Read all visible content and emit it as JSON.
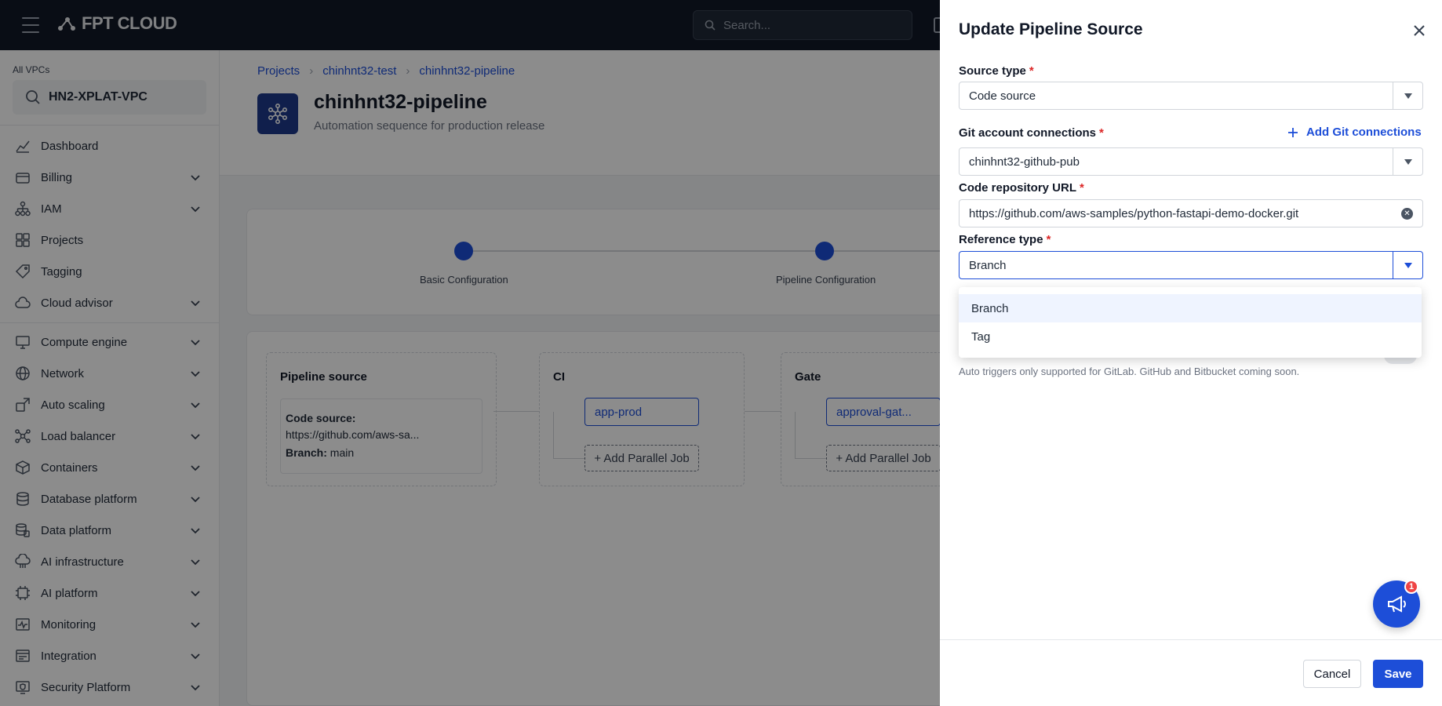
{
  "topbar": {
    "logo_text": "FPT CLOUD",
    "search_placeholder": "Search..."
  },
  "sidebar": {
    "vpc_label": "All VPCs",
    "vpc_value": "HN2-XPLAT-VPC",
    "items": [
      {
        "label": "Dashboard",
        "icon": "chart-icon"
      },
      {
        "label": "Billing",
        "icon": "wallet-icon"
      },
      {
        "label": "IAM",
        "icon": "org-icon"
      },
      {
        "label": "Projects",
        "icon": "grid-icon"
      },
      {
        "label": "Tagging",
        "icon": "tag-icon"
      },
      {
        "label": "Cloud advisor",
        "icon": "cloud-icon"
      },
      {
        "label": "Compute engine",
        "icon": "monitor-icon"
      },
      {
        "label": "Network",
        "icon": "globe-icon"
      },
      {
        "label": "Auto scaling",
        "icon": "scaling-icon"
      },
      {
        "label": "Load balancer",
        "icon": "balancer-icon"
      },
      {
        "label": "Containers",
        "icon": "cube-icon"
      },
      {
        "label": "Database platform",
        "icon": "database-icon"
      },
      {
        "label": "Data platform",
        "icon": "stack-icon"
      },
      {
        "label": "AI infrastructure",
        "icon": "cloud-chip-icon"
      },
      {
        "label": "AI platform",
        "icon": "ai-chip-icon"
      },
      {
        "label": "Monitoring",
        "icon": "pulse-icon"
      },
      {
        "label": "Integration",
        "icon": "api-icon"
      },
      {
        "label": "Security Platform",
        "icon": "shield-icon"
      }
    ]
  },
  "main": {
    "breadcrumb": [
      "Projects",
      "chinhnt32-test",
      "chinhnt32-pipeline"
    ],
    "title": "chinhnt32-pipeline",
    "subtitle": "Automation sequence for production release",
    "steps": [
      "Basic Configuration",
      "Pipeline Configuration"
    ],
    "stages": {
      "source": {
        "title": "Pipeline source",
        "code_label": "Code source:",
        "code_value": "https://github.com/aws-sa...",
        "branch_label": "Branch:",
        "branch_value": "main"
      },
      "ci": {
        "title": "CI",
        "job": "app-prod",
        "parallel": "+ Add Parallel Job"
      },
      "gate": {
        "title": "Gate",
        "job": "approval-gat...",
        "parallel": "+ Add Parallel Job"
      }
    }
  },
  "drawer": {
    "title": "Update Pipeline Source",
    "source_type_label": "Source type",
    "source_type_value": "Code source",
    "git_label": "Git account connections",
    "add_git_label": "Add Git connections",
    "git_value": "chinhnt32-github-pub",
    "repo_label": "Code repository URL",
    "repo_value": "https://github.com/aws-samples/python-fastapi-demo-docker.git",
    "ref_label": "Reference type",
    "ref_value": "Branch",
    "ref_options": [
      "Branch",
      "Tag"
    ],
    "hint": "Auto triggers only supported for GitLab. GitHub and Bitbucket coming soon.",
    "fab_badge": "1",
    "cancel_label": "Cancel",
    "save_label": "Save"
  },
  "colors": {
    "accent": "#1d4ed8",
    "topbar": "#111827",
    "required": "#dc2626",
    "badge": "#ef4444"
  }
}
